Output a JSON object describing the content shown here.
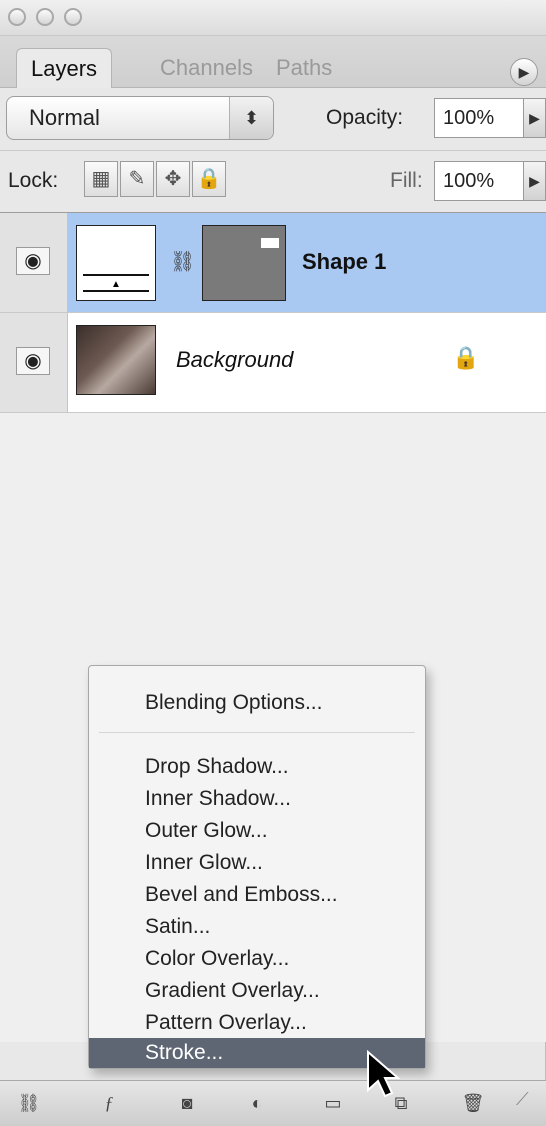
{
  "tabs": [
    {
      "label": "Layers",
      "active": true
    },
    {
      "label": "Channels",
      "active": false
    },
    {
      "label": "Paths",
      "active": false
    }
  ],
  "controls": {
    "blend_mode": "Normal",
    "opacity_label": "Opacity:",
    "opacity_value": "100%",
    "lock_label": "Lock:",
    "fill_label": "Fill:",
    "fill_value": "100%"
  },
  "layers": [
    {
      "name": "Shape 1",
      "selected": true,
      "visible": true,
      "locked": false
    },
    {
      "name": "Background",
      "selected": false,
      "visible": true,
      "locked": true
    }
  ],
  "context_menu": {
    "items": [
      {
        "label": "Blending Options..."
      },
      {
        "label": "Drop Shadow..."
      },
      {
        "label": "Inner Shadow..."
      },
      {
        "label": "Outer Glow..."
      },
      {
        "label": "Inner Glow..."
      },
      {
        "label": "Bevel and Emboss..."
      },
      {
        "label": "Satin..."
      },
      {
        "label": "Color Overlay..."
      },
      {
        "label": "Gradient Overlay..."
      },
      {
        "label": "Pattern Overlay..."
      },
      {
        "label": "Stroke..."
      }
    ],
    "selected_label": "Stroke..."
  },
  "colors": {
    "selected_layer_bg": "#a9c8f2",
    "menu_highlight": "#5f6673",
    "panel_bg": "#e8e8e8"
  },
  "icons": {
    "eye": "eye-icon",
    "lock": "lock-icon",
    "link": "link-icon",
    "fx": "fx-icon",
    "mask": "mask-icon",
    "adjustment": "adjustment-icon",
    "group": "folder-icon",
    "new_layer": "new-layer-icon",
    "trash": "trash-icon"
  }
}
